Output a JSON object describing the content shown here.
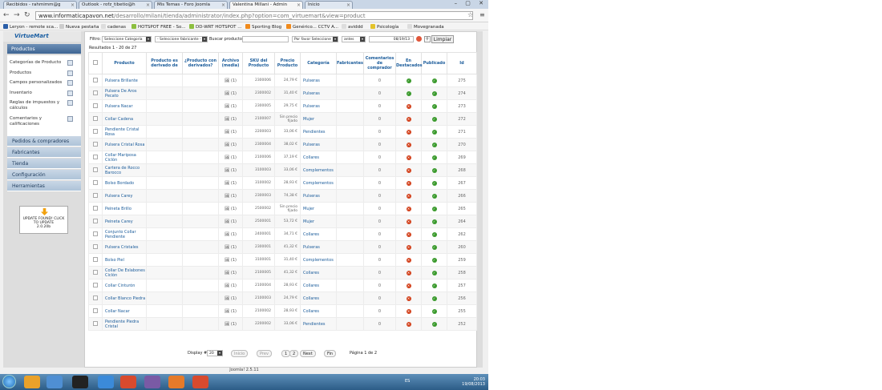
{
  "browser": {
    "tabs": [
      {
        "label": "Recibidos - rahmimm@g"
      },
      {
        "label": "Outlook - rofz_tibetio@h"
      },
      {
        "label": "Mis Temas - Foro Joomla"
      },
      {
        "label": "Valentina Millani - Admin"
      },
      {
        "label": "Inicio"
      }
    ],
    "url_host": "www.informaticapavon.net",
    "url_path": "/desarrollo/milani/tienda/administrator/index.php?option=com_virtuemart&view=product",
    "bookmarks": [
      "Leryon - remote sca...",
      "Nueva pestaña",
      "cadenas",
      "HOTSPOT FREE - So...",
      "DD-WRT HOTSPOT ...",
      "Sporting Blog",
      "Genérico... CCTV A...",
      "aviddd",
      "Psicología",
      "Movegranada"
    ]
  },
  "sidebar": {
    "logo": "VirtueMart",
    "section": "Productos",
    "subitems": [
      "Categorías de Producto",
      "Productos",
      "Campos personalizados",
      "Inventario",
      "Reglas de impuestos y cálculos",
      "Comentarios y calificaciones"
    ],
    "menu": [
      "Pedidos & compradores",
      "Fabricantes",
      "Tienda",
      "Configuración",
      "Herramientas"
    ],
    "update_text": "UPDATE FOUND! CLICK TO UPDATE",
    "update_version": "2.0.20b"
  },
  "filter": {
    "label": "Filtro:",
    "category": "Seleccione Categoría",
    "manufacturer": "- Seleccione fabricante -",
    "search_label": "Buscar producto:",
    "search_value": "",
    "date_mode": "Por favor Seleccione",
    "date_rel": "antes",
    "date": "08/19/13",
    "clear": "Limpiar"
  },
  "results": "Resultados 1 - 20 de 27",
  "columns": [
    "Producto",
    "Producto es derivado de",
    "¿Producto con derivados?",
    "Archivo (media)",
    "SKU del Producto",
    "Precio Producto",
    "Categoría",
    "Fabricantes",
    "Comentarios de comprador",
    "En Destacados",
    "Publicado",
    "Id"
  ],
  "rows": [
    {
      "name": "Pulsera Brillante",
      "media": "(1)",
      "sku": "2300006",
      "price": "24,79 €",
      "category": "Pulseras",
      "reviews": "0",
      "featured": true,
      "published": true,
      "id": "275"
    },
    {
      "name": "Pulsera De Aros Pecato",
      "media": "(1)",
      "sku": "2300002",
      "price": "31,40 €",
      "category": "Pulseras",
      "reviews": "0",
      "featured": true,
      "published": true,
      "id": "274"
    },
    {
      "name": "Pulsera Nacar",
      "media": "(1)",
      "sku": "2300005",
      "price": "29,75 €",
      "category": "Pulseras",
      "reviews": "0",
      "featured": false,
      "published": true,
      "id": "273"
    },
    {
      "name": "Collar Cadena",
      "media": "(1)",
      "sku": "2100007",
      "price": "Sin precio fijado",
      "category": "Mujer",
      "reviews": "0",
      "featured": false,
      "published": true,
      "id": "272"
    },
    {
      "name": "Pendiente Cristal Rosa",
      "media": "(1)",
      "sku": "2200003",
      "price": "33,06 €",
      "category": "Pendientes",
      "reviews": "0",
      "featured": false,
      "published": true,
      "id": "271"
    },
    {
      "name": "Pulsera Cristal Rosa",
      "media": "(1)",
      "sku": "2300004",
      "price": "38,02 €",
      "category": "Pulseras",
      "reviews": "0",
      "featured": false,
      "published": true,
      "id": "270"
    },
    {
      "name": "Collar Mariposa Ciclón",
      "media": "(1)",
      "sku": "2100006",
      "price": "37,19 €",
      "category": "Collares",
      "reviews": "0",
      "featured": false,
      "published": true,
      "id": "269"
    },
    {
      "name": "Cartera de Rocco Barocco",
      "media": "(1)",
      "sku": "3100003",
      "price": "33,06 €",
      "category": "Complementos",
      "reviews": "0",
      "featured": false,
      "published": true,
      "id": "268"
    },
    {
      "name": "Bolso Bordado",
      "media": "(1)",
      "sku": "3100002",
      "price": "28,93 €",
      "category": "Complementos",
      "reviews": "0",
      "featured": false,
      "published": true,
      "id": "267"
    },
    {
      "name": "Pulsera Carey",
      "media": "(1)",
      "sku": "2300003",
      "price": "74,38 €",
      "category": "Pulseras",
      "reviews": "0",
      "featured": false,
      "published": true,
      "id": "266"
    },
    {
      "name": "Peineta Brillo",
      "media": "(1)",
      "sku": "2500002",
      "price": "Sin precio fijado",
      "category": "Mujer",
      "reviews": "0",
      "featured": false,
      "published": true,
      "id": "265"
    },
    {
      "name": "Peineta Carey",
      "media": "(1)",
      "sku": "2500001",
      "price": "53,72 €",
      "category": "Mujer",
      "reviews": "0",
      "featured": false,
      "published": true,
      "id": "264"
    },
    {
      "name": "Conjunto Collar Pendiente",
      "media": "(1)",
      "sku": "2400001",
      "price": "34,71 €",
      "category": "Collares",
      "reviews": "0",
      "featured": false,
      "published": true,
      "id": "262"
    },
    {
      "name": "Pulsera Cristales",
      "media": "(1)",
      "sku": "2300001",
      "price": "41,32 €",
      "category": "Pulseras",
      "reviews": "0",
      "featured": false,
      "published": true,
      "id": "260"
    },
    {
      "name": "Bolso Piel",
      "media": "(1)",
      "sku": "3100001",
      "price": "31,40 €",
      "category": "Complementos",
      "reviews": "0",
      "featured": false,
      "published": true,
      "id": "259"
    },
    {
      "name": "Collar De Eslabones Ciclón",
      "media": "(1)",
      "sku": "2100005",
      "price": "41,32 €",
      "category": "Collares",
      "reviews": "0",
      "featured": false,
      "published": true,
      "id": "258"
    },
    {
      "name": "Collar Cinturón",
      "media": "(1)",
      "sku": "2100004",
      "price": "28,93 €",
      "category": "Collares",
      "reviews": "0",
      "featured": false,
      "published": true,
      "id": "257"
    },
    {
      "name": "Collar Blanco Piedra",
      "media": "(1)",
      "sku": "2100003",
      "price": "24,79 €",
      "category": "Collares",
      "reviews": "0",
      "featured": false,
      "published": true,
      "id": "256"
    },
    {
      "name": "Collar Nacar",
      "media": "(1)",
      "sku": "2100002",
      "price": "28,93 €",
      "category": "Collares",
      "reviews": "0",
      "featured": false,
      "published": true,
      "id": "255"
    },
    {
      "name": "Pendiente Piedra Cristal",
      "media": "(1)",
      "sku": "2200002",
      "price": "33,06 €",
      "category": "Pendientes",
      "reviews": "0",
      "featured": false,
      "published": true,
      "id": "252"
    }
  ],
  "pager": {
    "display_label": "Display #",
    "display_value": "20",
    "start": "Inicio",
    "prev": "Prev",
    "page1": "1",
    "page2": "2",
    "next": "Next",
    "end": "Fin",
    "page_info": "Página 1 de 2"
  },
  "footer": "Joomla! 2.5.11",
  "taskbar": {
    "lang": "ES",
    "time": "20:03",
    "date": "19/08/2013"
  },
  "colors": {
    "accent": "#1a5b9a",
    "ok": "#3a9a2c",
    "no": "#d3431e",
    "menu": "#3e6593"
  }
}
